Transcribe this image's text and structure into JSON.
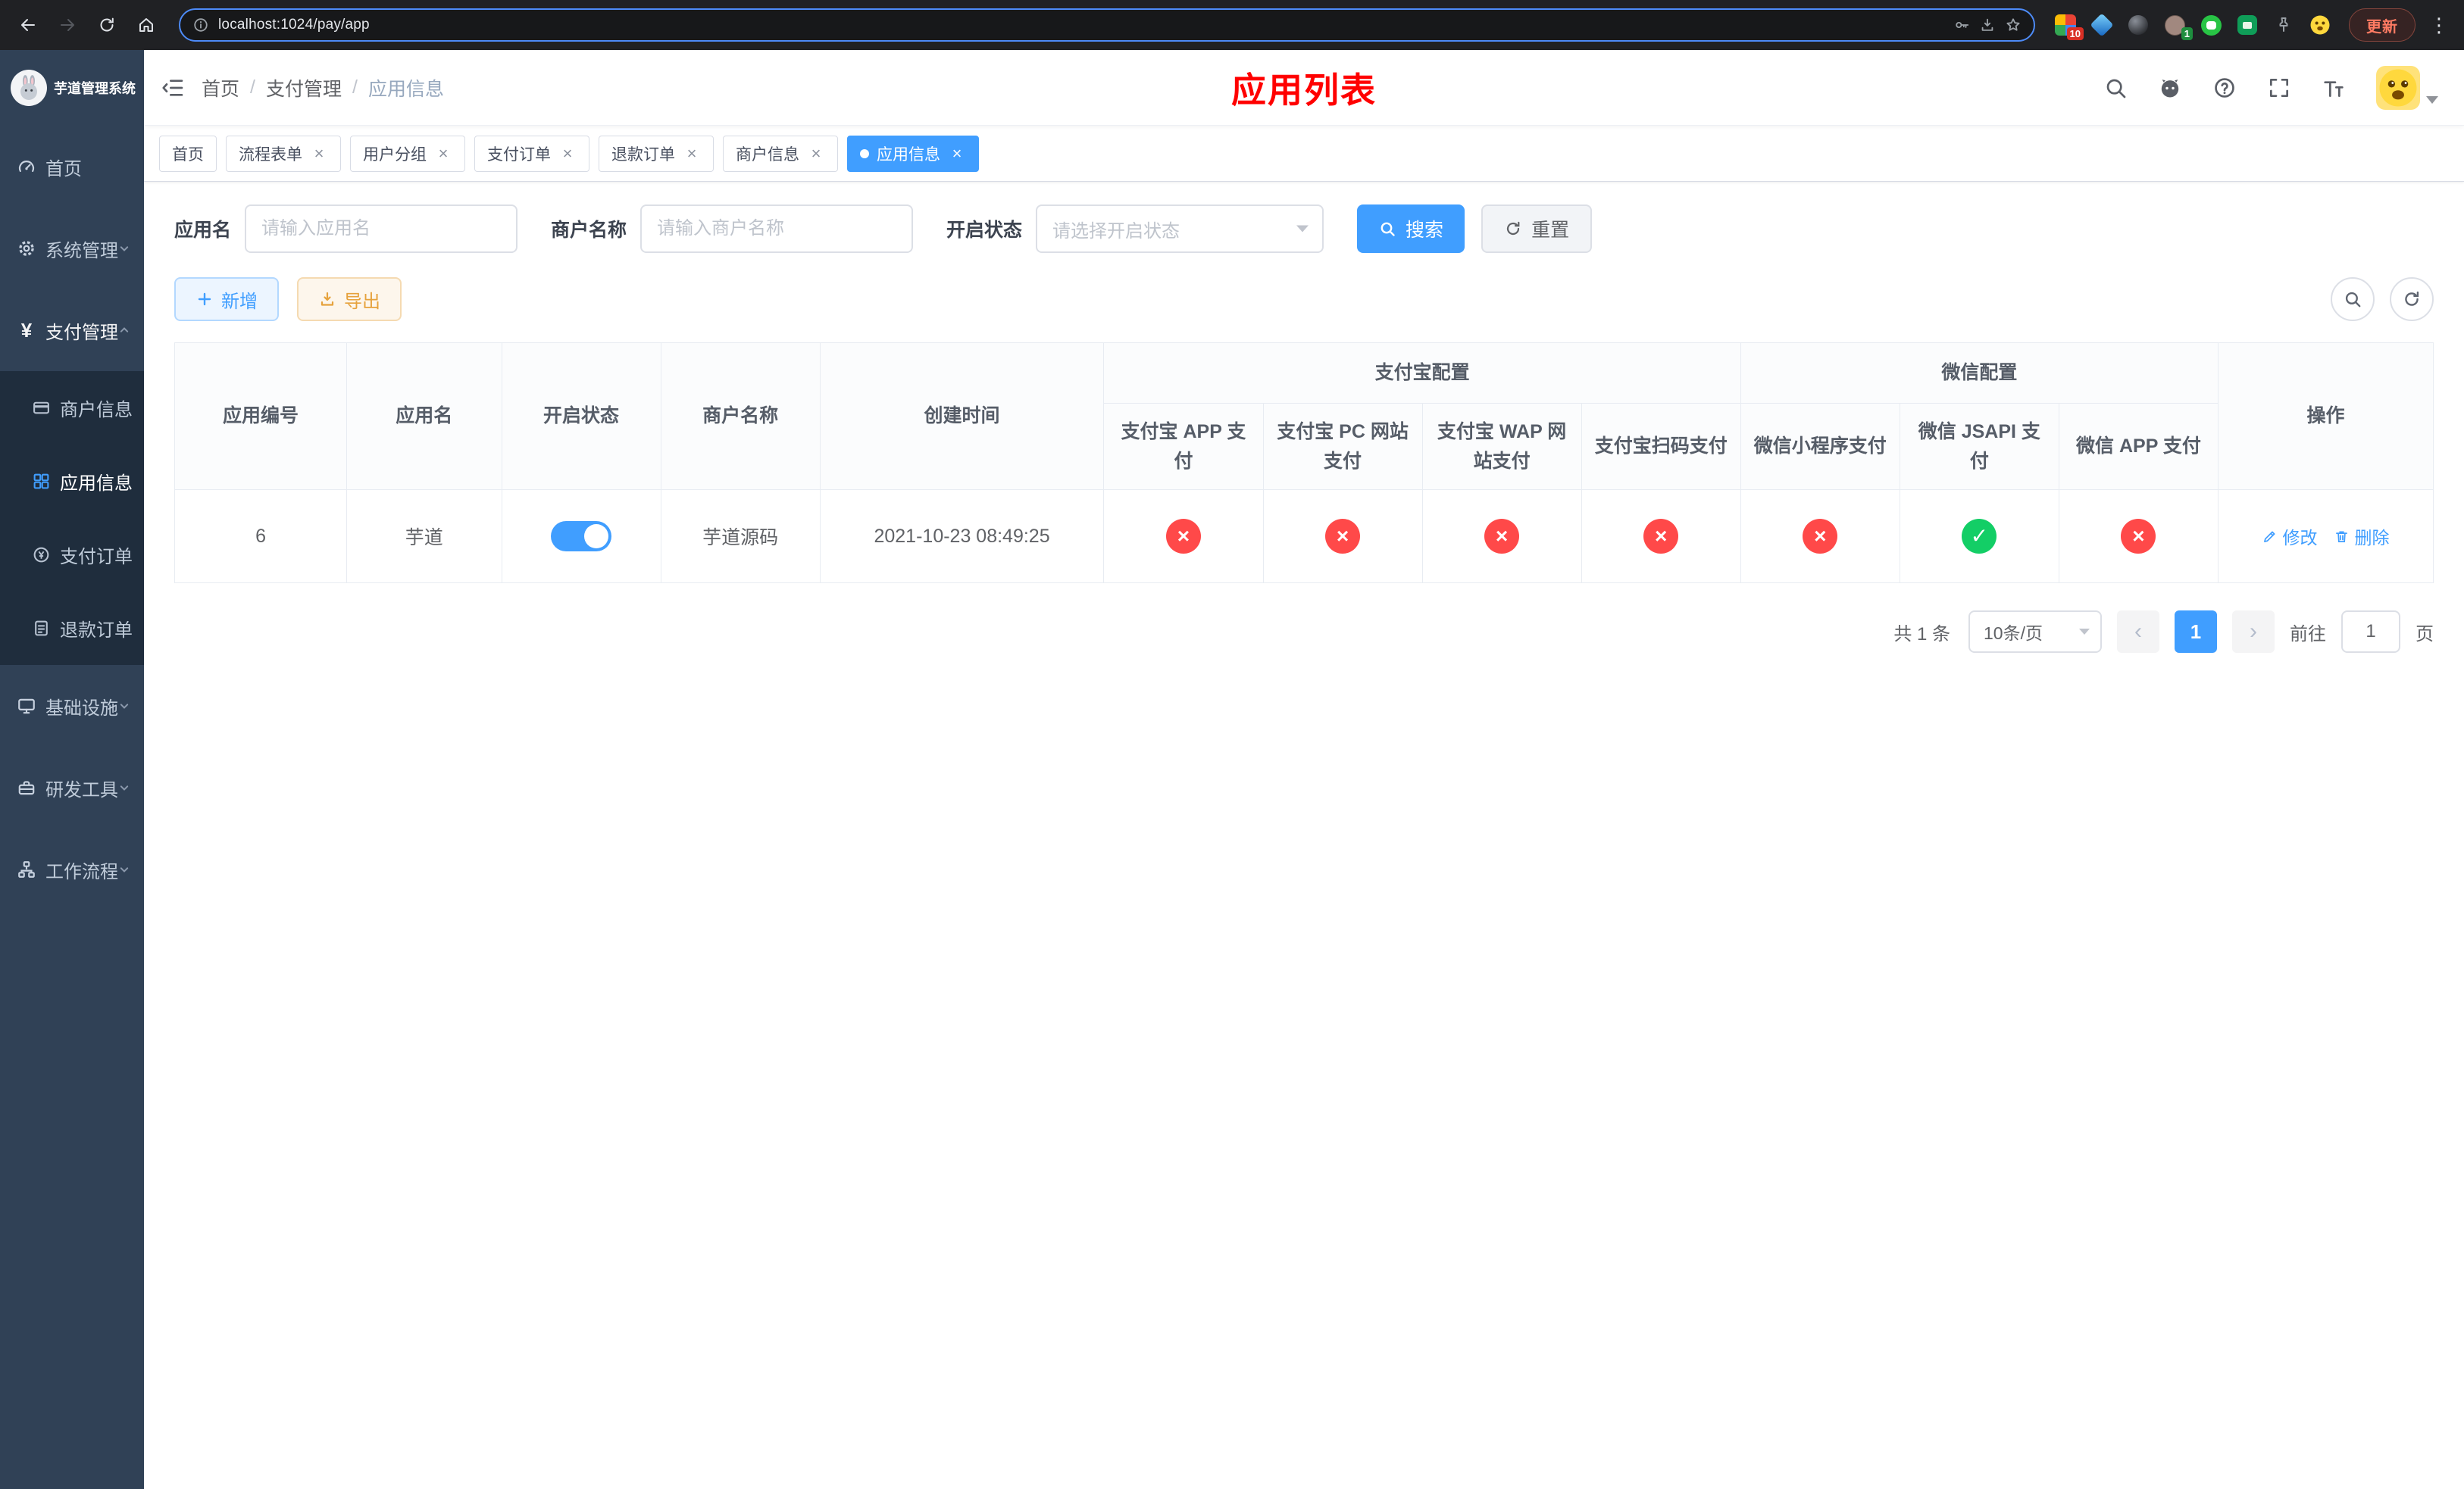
{
  "colors": {
    "accent": "#409eff",
    "success": "#13ce66",
    "danger": "#ff4949",
    "sidebar_bg": "#304156",
    "submenu_bg": "#1f2d3d",
    "annotation_red": "#ff0000"
  },
  "browser": {
    "url": "localhost:1024/pay/app",
    "update_button": "更新",
    "badges": {
      "puzzle": "10",
      "avatar": "1"
    },
    "icons": [
      "back-icon",
      "forward-icon",
      "reload-icon",
      "home-icon",
      "info-icon",
      "key-icon",
      "install-icon",
      "star-icon",
      "kebab-menu-icon"
    ]
  },
  "sidebar": {
    "title": "芋道管理系统",
    "items": [
      {
        "label": "首页",
        "icon": "dashboard-icon"
      },
      {
        "label": "系统管理",
        "icon": "gear-icon",
        "expandable": true
      },
      {
        "label": "支付管理",
        "icon": "yen-icon",
        "expandable": true,
        "expanded": true
      },
      {
        "label": "商户信息",
        "icon": "card-icon",
        "submenu": true
      },
      {
        "label": "应用信息",
        "icon": "grid-icon",
        "submenu": true,
        "active": true
      },
      {
        "label": "支付订单",
        "icon": "coin-icon",
        "submenu": true
      },
      {
        "label": "退款订单",
        "icon": "document-icon",
        "submenu": true
      },
      {
        "label": "基础设施",
        "icon": "monitor-icon",
        "expandable": true
      },
      {
        "label": "研发工具",
        "icon": "toolbox-icon",
        "expandable": true
      },
      {
        "label": "工作流程",
        "icon": "workflow-icon",
        "expandable": true
      }
    ]
  },
  "navbar": {
    "breadcrumb": [
      "首页",
      "支付管理",
      "应用信息"
    ],
    "page_title": "应用列表",
    "icons": [
      "search-icon",
      "github-icon",
      "help-icon",
      "fullscreen-icon",
      "font-size-icon",
      "avatar",
      "chevron-down-icon"
    ]
  },
  "tabs": [
    {
      "label": "首页",
      "closable": false
    },
    {
      "label": "流程表单",
      "closable": true
    },
    {
      "label": "用户分组",
      "closable": true
    },
    {
      "label": "支付订单",
      "closable": true
    },
    {
      "label": "退款订单",
      "closable": true
    },
    {
      "label": "商户信息",
      "closable": true
    },
    {
      "label": "应用信息",
      "closable": true,
      "active": true
    }
  ],
  "filters": {
    "app_name": {
      "label": "应用名",
      "placeholder": "请输入应用名",
      "value": ""
    },
    "merchant": {
      "label": "商户名称",
      "placeholder": "请输入商户名称",
      "value": ""
    },
    "status": {
      "label": "开启状态",
      "placeholder": "请选择开启状态",
      "value": ""
    },
    "search_label": "搜索",
    "reset_label": "重置"
  },
  "actions": {
    "add_label": "新增",
    "export_label": "导出"
  },
  "table": {
    "group_headers": {
      "alipay": "支付宝配置",
      "wechat": "微信配置"
    },
    "columns": {
      "id": "应用编号",
      "name": "应用名",
      "status": "开启状态",
      "merchant": "商户名称",
      "created": "创建时间",
      "alipay_app": "支付宝 APP 支付",
      "alipay_pc": "支付宝 PC 网站支付",
      "alipay_wap": "支付宝 WAP 网站支付",
      "alipay_qr": "支付宝扫码支付",
      "wx_mini": "微信小程序支付",
      "wx_jsapi": "微信 JSAPI 支付",
      "wx_app": "微信 APP 支付",
      "actions": "操作"
    },
    "rows": [
      {
        "id": "6",
        "name": "芋道",
        "enabled": true,
        "merchant": "芋道源码",
        "created": "2021-10-23 08:49:25",
        "statuses": [
          false,
          false,
          false,
          false,
          false,
          true,
          false
        ],
        "edit_label": "修改",
        "delete_label": "删除"
      }
    ]
  },
  "pagination": {
    "total": "共 1 条",
    "page_size": "10条/页",
    "current_page": "1",
    "goto_label": "前往",
    "page_unit": "页",
    "jump_value": "1"
  }
}
